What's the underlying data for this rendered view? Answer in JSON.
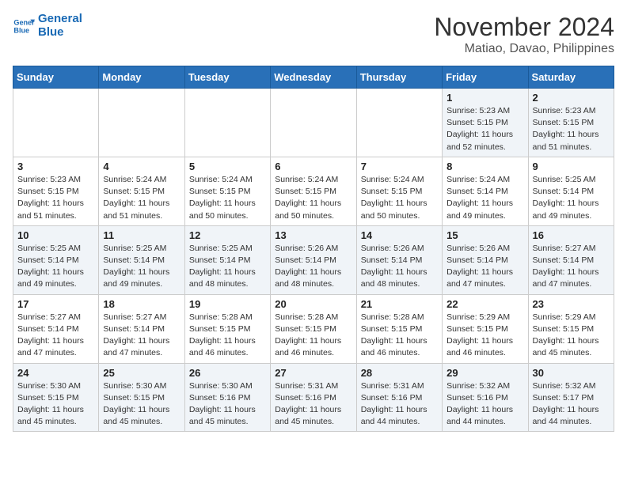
{
  "header": {
    "logo_line1": "General",
    "logo_line2": "Blue",
    "title": "November 2024",
    "subtitle": "Matiao, Davao, Philippines"
  },
  "weekdays": [
    "Sunday",
    "Monday",
    "Tuesday",
    "Wednesday",
    "Thursday",
    "Friday",
    "Saturday"
  ],
  "weeks": [
    [
      {
        "day": "",
        "info": ""
      },
      {
        "day": "",
        "info": ""
      },
      {
        "day": "",
        "info": ""
      },
      {
        "day": "",
        "info": ""
      },
      {
        "day": "",
        "info": ""
      },
      {
        "day": "1",
        "info": "Sunrise: 5:23 AM\nSunset: 5:15 PM\nDaylight: 11 hours\nand 52 minutes."
      },
      {
        "day": "2",
        "info": "Sunrise: 5:23 AM\nSunset: 5:15 PM\nDaylight: 11 hours\nand 51 minutes."
      }
    ],
    [
      {
        "day": "3",
        "info": "Sunrise: 5:23 AM\nSunset: 5:15 PM\nDaylight: 11 hours\nand 51 minutes."
      },
      {
        "day": "4",
        "info": "Sunrise: 5:24 AM\nSunset: 5:15 PM\nDaylight: 11 hours\nand 51 minutes."
      },
      {
        "day": "5",
        "info": "Sunrise: 5:24 AM\nSunset: 5:15 PM\nDaylight: 11 hours\nand 50 minutes."
      },
      {
        "day": "6",
        "info": "Sunrise: 5:24 AM\nSunset: 5:15 PM\nDaylight: 11 hours\nand 50 minutes."
      },
      {
        "day": "7",
        "info": "Sunrise: 5:24 AM\nSunset: 5:15 PM\nDaylight: 11 hours\nand 50 minutes."
      },
      {
        "day": "8",
        "info": "Sunrise: 5:24 AM\nSunset: 5:14 PM\nDaylight: 11 hours\nand 49 minutes."
      },
      {
        "day": "9",
        "info": "Sunrise: 5:25 AM\nSunset: 5:14 PM\nDaylight: 11 hours\nand 49 minutes."
      }
    ],
    [
      {
        "day": "10",
        "info": "Sunrise: 5:25 AM\nSunset: 5:14 PM\nDaylight: 11 hours\nand 49 minutes."
      },
      {
        "day": "11",
        "info": "Sunrise: 5:25 AM\nSunset: 5:14 PM\nDaylight: 11 hours\nand 49 minutes."
      },
      {
        "day": "12",
        "info": "Sunrise: 5:25 AM\nSunset: 5:14 PM\nDaylight: 11 hours\nand 48 minutes."
      },
      {
        "day": "13",
        "info": "Sunrise: 5:26 AM\nSunset: 5:14 PM\nDaylight: 11 hours\nand 48 minutes."
      },
      {
        "day": "14",
        "info": "Sunrise: 5:26 AM\nSunset: 5:14 PM\nDaylight: 11 hours\nand 48 minutes."
      },
      {
        "day": "15",
        "info": "Sunrise: 5:26 AM\nSunset: 5:14 PM\nDaylight: 11 hours\nand 47 minutes."
      },
      {
        "day": "16",
        "info": "Sunrise: 5:27 AM\nSunset: 5:14 PM\nDaylight: 11 hours\nand 47 minutes."
      }
    ],
    [
      {
        "day": "17",
        "info": "Sunrise: 5:27 AM\nSunset: 5:14 PM\nDaylight: 11 hours\nand 47 minutes."
      },
      {
        "day": "18",
        "info": "Sunrise: 5:27 AM\nSunset: 5:14 PM\nDaylight: 11 hours\nand 47 minutes."
      },
      {
        "day": "19",
        "info": "Sunrise: 5:28 AM\nSunset: 5:15 PM\nDaylight: 11 hours\nand 46 minutes."
      },
      {
        "day": "20",
        "info": "Sunrise: 5:28 AM\nSunset: 5:15 PM\nDaylight: 11 hours\nand 46 minutes."
      },
      {
        "day": "21",
        "info": "Sunrise: 5:28 AM\nSunset: 5:15 PM\nDaylight: 11 hours\nand 46 minutes."
      },
      {
        "day": "22",
        "info": "Sunrise: 5:29 AM\nSunset: 5:15 PM\nDaylight: 11 hours\nand 46 minutes."
      },
      {
        "day": "23",
        "info": "Sunrise: 5:29 AM\nSunset: 5:15 PM\nDaylight: 11 hours\nand 45 minutes."
      }
    ],
    [
      {
        "day": "24",
        "info": "Sunrise: 5:30 AM\nSunset: 5:15 PM\nDaylight: 11 hours\nand 45 minutes."
      },
      {
        "day": "25",
        "info": "Sunrise: 5:30 AM\nSunset: 5:15 PM\nDaylight: 11 hours\nand 45 minutes."
      },
      {
        "day": "26",
        "info": "Sunrise: 5:30 AM\nSunset: 5:16 PM\nDaylight: 11 hours\nand 45 minutes."
      },
      {
        "day": "27",
        "info": "Sunrise: 5:31 AM\nSunset: 5:16 PM\nDaylight: 11 hours\nand 45 minutes."
      },
      {
        "day": "28",
        "info": "Sunrise: 5:31 AM\nSunset: 5:16 PM\nDaylight: 11 hours\nand 44 minutes."
      },
      {
        "day": "29",
        "info": "Sunrise: 5:32 AM\nSunset: 5:16 PM\nDaylight: 11 hours\nand 44 minutes."
      },
      {
        "day": "30",
        "info": "Sunrise: 5:32 AM\nSunset: 5:17 PM\nDaylight: 11 hours\nand 44 minutes."
      }
    ]
  ]
}
